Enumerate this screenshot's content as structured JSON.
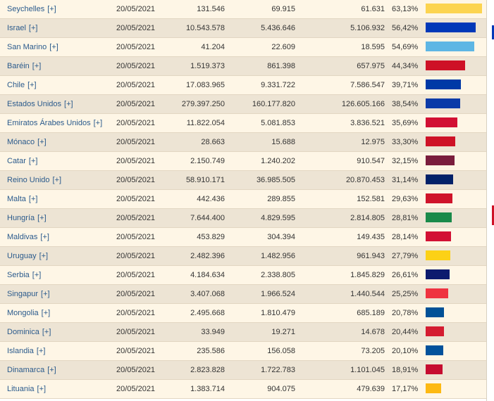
{
  "table": {
    "rows": [
      {
        "country": "Seychelles",
        "expand": "[+]",
        "date": "20/05/2021",
        "population": "131.546",
        "vaccinated": "69.915",
        "fully_vaccinated": "61.631",
        "percent": "63,13%",
        "percent_value": 63.13,
        "bar_color": "#fcd450"
      },
      {
        "country": "Israel",
        "expand": "[+]",
        "date": "20/05/2021",
        "population": "10.543.578",
        "vaccinated": "5.436.646",
        "fully_vaccinated": "5.106.932",
        "percent": "56,42%",
        "percent_value": 56.42,
        "bar_color": "#0038b8"
      },
      {
        "country": "San Marino",
        "expand": "[+]",
        "date": "20/05/2021",
        "population": "41.204",
        "vaccinated": "22.609",
        "fully_vaccinated": "18.595",
        "percent": "54,69%",
        "percent_value": 54.69,
        "bar_color": "#5eb6e4"
      },
      {
        "country": "Baréin",
        "expand": "[+]",
        "date": "20/05/2021",
        "population": "1.519.373",
        "vaccinated": "861.398",
        "fully_vaccinated": "657.975",
        "percent": "44,34%",
        "percent_value": 44.34,
        "bar_color": "#ce1126"
      },
      {
        "country": "Chile",
        "expand": "[+]",
        "date": "20/05/2021",
        "population": "17.083.965",
        "vaccinated": "9.331.722",
        "fully_vaccinated": "7.586.547",
        "percent": "39,71%",
        "percent_value": 39.71,
        "bar_color": "#0039a6"
      },
      {
        "country": "Estados Unidos",
        "expand": "[+]",
        "date": "20/05/2021",
        "population": "279.397.250",
        "vaccinated": "160.177.820",
        "fully_vaccinated": "126.605.166",
        "percent": "38,54%",
        "percent_value": 38.54,
        "bar_color": "#0a3aa8"
      },
      {
        "country": "Emiratos Árabes Unidos",
        "expand": "[+]",
        "date": "20/05/2021",
        "population": "11.822.054",
        "vaccinated": "5.081.853",
        "fully_vaccinated": "3.836.521",
        "percent": "35,69%",
        "percent_value": 35.69,
        "bar_color": "#d21034"
      },
      {
        "country": "Mónaco",
        "expand": "[+]",
        "date": "20/05/2021",
        "population": "28.663",
        "vaccinated": "15.688",
        "fully_vaccinated": "12.975",
        "percent": "33,30%",
        "percent_value": 33.3,
        "bar_color": "#ce1126"
      },
      {
        "country": "Catar",
        "expand": "[+]",
        "date": "20/05/2021",
        "population": "2.150.749",
        "vaccinated": "1.240.202",
        "fully_vaccinated": "910.547",
        "percent": "32,15%",
        "percent_value": 32.15,
        "bar_color": "#7a1d3d"
      },
      {
        "country": "Reino Unido",
        "expand": "[+]",
        "date": "20/05/2021",
        "population": "58.910.171",
        "vaccinated": "36.985.505",
        "fully_vaccinated": "20.870.453",
        "percent": "31,14%",
        "percent_value": 31.14,
        "bar_color": "#012169"
      },
      {
        "country": "Malta",
        "expand": "[+]",
        "date": "20/05/2021",
        "population": "442.436",
        "vaccinated": "289.855",
        "fully_vaccinated": "152.581",
        "percent": "29,63%",
        "percent_value": 29.63,
        "bar_color": "#cf142b"
      },
      {
        "country": "Hungría",
        "expand": "[+]",
        "date": "20/05/2021",
        "population": "7.644.400",
        "vaccinated": "4.829.595",
        "fully_vaccinated": "2.814.805",
        "percent": "28,81%",
        "percent_value": 28.81,
        "bar_color": "#1a8a4a"
      },
      {
        "country": "Maldivas",
        "expand": "[+]",
        "date": "20/05/2021",
        "population": "453.829",
        "vaccinated": "304.394",
        "fully_vaccinated": "149.435",
        "percent": "28,14%",
        "percent_value": 28.14,
        "bar_color": "#d21034"
      },
      {
        "country": "Uruguay",
        "expand": "[+]",
        "date": "20/05/2021",
        "population": "2.482.396",
        "vaccinated": "1.482.956",
        "fully_vaccinated": "961.943",
        "percent": "27,79%",
        "percent_value": 27.79,
        "bar_color": "#fcd116"
      },
      {
        "country": "Serbia",
        "expand": "[+]",
        "date": "20/05/2021",
        "population": "4.184.634",
        "vaccinated": "2.338.805",
        "fully_vaccinated": "1.845.829",
        "percent": "26,61%",
        "percent_value": 26.61,
        "bar_color": "#0c1a6e"
      },
      {
        "country": "Singapur",
        "expand": "[+]",
        "date": "20/05/2021",
        "population": "3.407.068",
        "vaccinated": "1.966.524",
        "fully_vaccinated": "1.440.544",
        "percent": "25,25%",
        "percent_value": 25.25,
        "bar_color": "#ef3340"
      },
      {
        "country": "Mongolia",
        "expand": "[+]",
        "date": "20/05/2021",
        "population": "2.495.668",
        "vaccinated": "1.810.479",
        "fully_vaccinated": "685.189",
        "percent": "20,78%",
        "percent_value": 20.78,
        "bar_color": "#015197"
      },
      {
        "country": "Dominica",
        "expand": "[+]",
        "date": "20/05/2021",
        "population": "33.949",
        "vaccinated": "19.271",
        "fully_vaccinated": "14.678",
        "percent": "20,44%",
        "percent_value": 20.44,
        "bar_color": "#d41c30"
      },
      {
        "country": "Islandia",
        "expand": "[+]",
        "date": "20/05/2021",
        "population": "235.586",
        "vaccinated": "156.058",
        "fully_vaccinated": "73.205",
        "percent": "20,10%",
        "percent_value": 20.1,
        "bar_color": "#02529c"
      },
      {
        "country": "Dinamarca",
        "expand": "[+]",
        "date": "20/05/2021",
        "population": "2.823.828",
        "vaccinated": "1.722.783",
        "fully_vaccinated": "1.101.045",
        "percent": "18,91%",
        "percent_value": 18.91,
        "bar_color": "#c60c30"
      },
      {
        "country": "Lituania",
        "expand": "[+]",
        "date": "20/05/2021",
        "population": "1.383.714",
        "vaccinated": "904.075",
        "fully_vaccinated": "479.639",
        "percent": "17,17%",
        "percent_value": 17.17,
        "bar_color": "#fdb913"
      }
    ]
  },
  "right_strip": {
    "marks": [
      {
        "color": "#0038b8"
      },
      {
        "color": "#ce1126"
      }
    ]
  }
}
